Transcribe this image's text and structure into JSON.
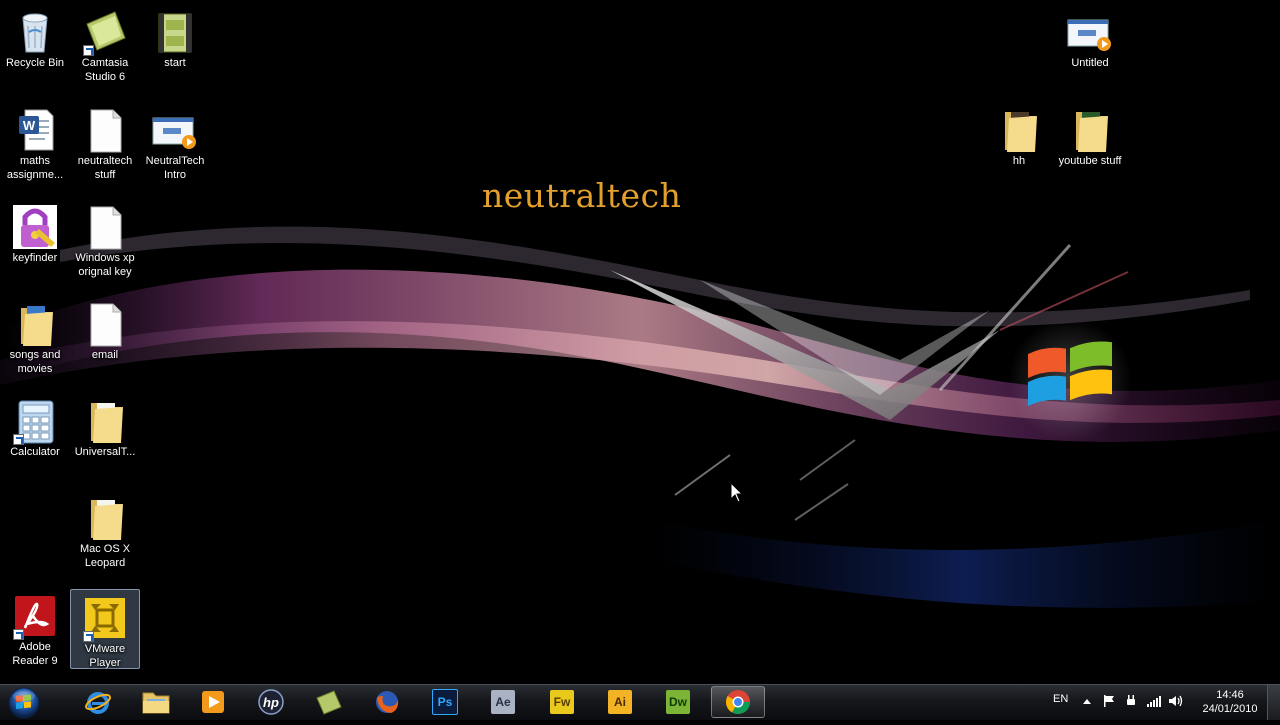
{
  "wallpaper": {
    "watermark": "neutraltech"
  },
  "desktop_icons": [
    {
      "id": "recycle-bin",
      "label": "Recycle Bin"
    },
    {
      "id": "camtasia",
      "label": "Camtasia\nStudio 6"
    },
    {
      "id": "start",
      "label": "start"
    },
    {
      "id": "maths",
      "label": "maths\nassignme..."
    },
    {
      "id": "neutraltech-stuff",
      "label": "neutraltech\nstuff"
    },
    {
      "id": "neutraltech-intro",
      "label": "NeutralTech\nIntro"
    },
    {
      "id": "keyfinder",
      "label": "keyfinder"
    },
    {
      "id": "winxp-key",
      "label": "Windows xp\norignal key"
    },
    {
      "id": "songs",
      "label": "songs and\nmovies"
    },
    {
      "id": "email",
      "label": "email"
    },
    {
      "id": "calculator",
      "label": "Calculator"
    },
    {
      "id": "universal",
      "label": "UniversalT..."
    },
    {
      "id": "macosx",
      "label": "Mac OS X\nLeopard"
    },
    {
      "id": "adobe-reader",
      "label": "Adobe\nReader 9"
    },
    {
      "id": "vmware",
      "label": "VMware\nPlayer"
    },
    {
      "id": "untitled",
      "label": "Untitled"
    },
    {
      "id": "hh",
      "label": "hh"
    },
    {
      "id": "youtube",
      "label": "youtube stuff"
    }
  ],
  "taskbar": {
    "apps": [
      {
        "id": "ie",
        "name": "internet-explorer"
      },
      {
        "id": "explorer",
        "name": "windows-explorer"
      },
      {
        "id": "media",
        "name": "media-player"
      },
      {
        "id": "hp",
        "name": "hp"
      },
      {
        "id": "camtasia",
        "name": "camtasia"
      },
      {
        "id": "firefox",
        "name": "firefox"
      },
      {
        "id": "ps",
        "name": "photoshop",
        "abbr": "Ps",
        "bg": "#0b1b3c",
        "fg": "#31a8ff"
      },
      {
        "id": "ae",
        "name": "after-effects",
        "abbr": "Ae",
        "bg": "#a9b3c4",
        "fg": "#2b2f46"
      },
      {
        "id": "fw",
        "name": "fireworks",
        "abbr": "Fw",
        "bg": "#e8c91c",
        "fg": "#5a3c00"
      },
      {
        "id": "ai",
        "name": "illustrator",
        "abbr": "Ai",
        "bg": "#f2b324",
        "fg": "#4a2a00"
      },
      {
        "id": "dw",
        "name": "dreamweaver",
        "abbr": "Dw",
        "bg": "#7bb437",
        "fg": "#123a06"
      },
      {
        "id": "chrome",
        "name": "chrome"
      }
    ],
    "tray": {
      "language": "EN",
      "time": "14:46",
      "date": "24/01/2010"
    }
  }
}
